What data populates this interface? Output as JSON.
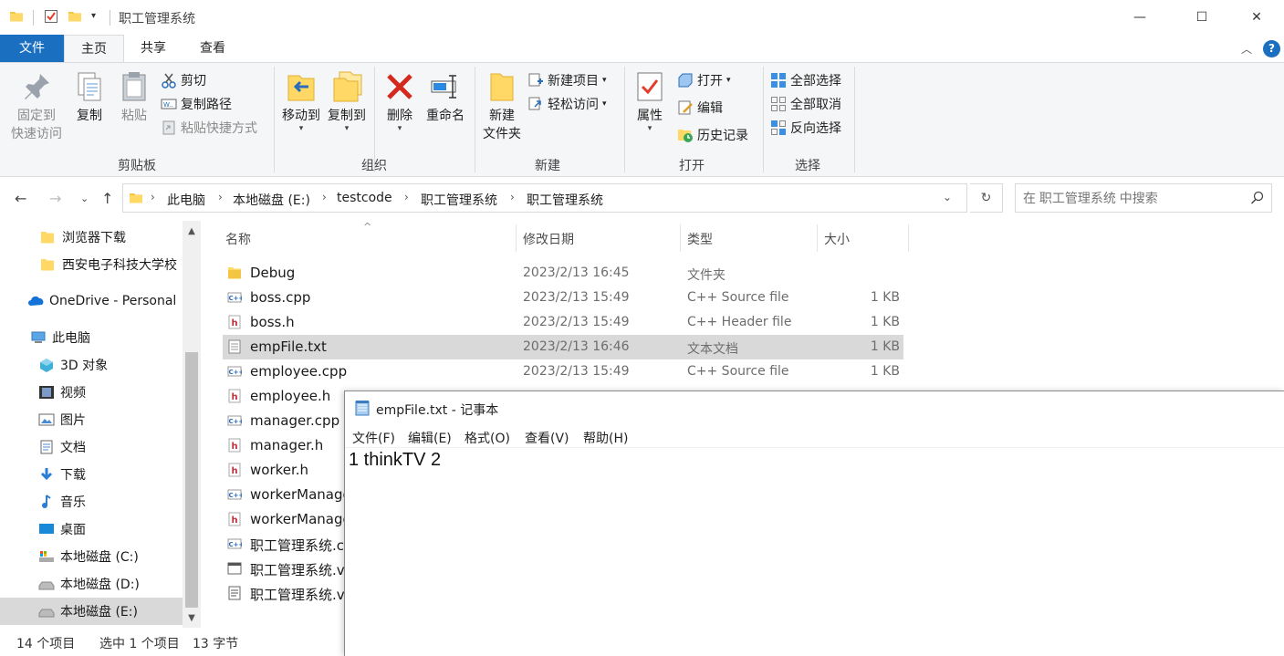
{
  "window": {
    "title": "职工管理系统",
    "minimize_glyph": "—",
    "maximize_glyph": "☐",
    "close_glyph": "✕"
  },
  "ribbon_tabs": [
    {
      "label": "文件"
    },
    {
      "label": "主页"
    },
    {
      "label": "共享"
    },
    {
      "label": "查看"
    }
  ],
  "ribbon": {
    "clipboard": {
      "pin": "固定到\n快速访问",
      "pin_line1": "固定到",
      "pin_line2": "快速访问",
      "copy": "复制",
      "paste": "粘贴",
      "cut": "剪切",
      "copy_path": "复制路径",
      "paste_shortcut": "粘贴快捷方式",
      "group_label": "剪贴板"
    },
    "organize": {
      "move_to": "移动到",
      "copy_to": "复制到",
      "delete": "删除",
      "rename": "重命名",
      "group_label": "组织"
    },
    "new": {
      "new_folder_line1": "新建",
      "new_folder_line2": "文件夹",
      "new_item": "新建项目",
      "easy_access": "轻松访问",
      "group_label": "新建"
    },
    "open": {
      "properties": "属性",
      "open": "打开",
      "edit": "编辑",
      "history": "历史记录",
      "group_label": "打开"
    },
    "select": {
      "select_all": "全部选择",
      "select_none": "全部取消",
      "invert": "反向选择",
      "group_label": "选择"
    }
  },
  "address": {
    "breadcrumbs": [
      "此电脑",
      "本地磁盘 (E:)",
      "testcode",
      "职工管理系统",
      "职工管理系统"
    ],
    "search_placeholder": "在 职工管理系统 中搜索"
  },
  "nav_pane": {
    "items": [
      {
        "label": "浏览器下载",
        "icon": "folder-icon"
      },
      {
        "label": "西安电子科技大学校",
        "icon": "folder-icon"
      },
      {
        "label": "OneDrive - Personal",
        "icon": "onedrive-icon"
      },
      {
        "label": "此电脑",
        "icon": "computer-icon"
      },
      {
        "label": "3D 对象",
        "icon": "3d-objects-icon"
      },
      {
        "label": "视频",
        "icon": "videos-icon"
      },
      {
        "label": "图片",
        "icon": "pictures-icon"
      },
      {
        "label": "文档",
        "icon": "documents-icon"
      },
      {
        "label": "下载",
        "icon": "downloads-icon"
      },
      {
        "label": "音乐",
        "icon": "music-icon"
      },
      {
        "label": "桌面",
        "icon": "desktop-icon"
      },
      {
        "label": "本地磁盘 (C:)",
        "icon": "drive-c-icon"
      },
      {
        "label": "本地磁盘 (D:)",
        "icon": "drive-icon"
      },
      {
        "label": "本地磁盘 (E:)",
        "icon": "drive-icon"
      }
    ]
  },
  "file_list": {
    "columns": [
      "名称",
      "修改日期",
      "类型",
      "大小"
    ],
    "rows": [
      {
        "name": "Debug",
        "date": "2023/2/13 16:45",
        "type": "文件夹",
        "size": "",
        "icon": "folder-icon"
      },
      {
        "name": "boss.cpp",
        "date": "2023/2/13 15:49",
        "type": "C++ Source file",
        "size": "1 KB",
        "icon": "cpp-file-icon"
      },
      {
        "name": "boss.h",
        "date": "2023/2/13 15:49",
        "type": "C++ Header file",
        "size": "1 KB",
        "icon": "header-file-icon"
      },
      {
        "name": "empFile.txt",
        "date": "2023/2/13 16:46",
        "type": "文本文档",
        "size": "1 KB",
        "icon": "text-file-icon"
      },
      {
        "name": "employee.cpp",
        "date": "2023/2/13 15:49",
        "type": "C++ Source file",
        "size": "1 KB",
        "icon": "cpp-file-icon"
      },
      {
        "name": "employee.h",
        "date": "",
        "type": "",
        "size": "",
        "icon": "header-file-icon"
      },
      {
        "name": "manager.cpp",
        "date": "",
        "type": "",
        "size": "",
        "icon": "cpp-file-icon"
      },
      {
        "name": "manager.h",
        "date": "",
        "type": "",
        "size": "",
        "icon": "header-file-icon"
      },
      {
        "name": "worker.h",
        "date": "",
        "type": "",
        "size": "",
        "icon": "header-file-icon"
      },
      {
        "name": "workerManage",
        "date": "",
        "type": "",
        "size": "",
        "icon": "cpp-file-icon"
      },
      {
        "name": "workerManage",
        "date": "",
        "type": "",
        "size": "",
        "icon": "header-file-icon"
      },
      {
        "name": "职工管理系统.c",
        "date": "",
        "type": "",
        "size": "",
        "icon": "cpp-file-icon"
      },
      {
        "name": "职工管理系统.v",
        "date": "",
        "type": "",
        "size": "",
        "icon": "vcxproj-file-icon"
      },
      {
        "name": "职工管理系统.v",
        "date": "",
        "type": "",
        "size": "",
        "icon": "filters-file-icon"
      }
    ]
  },
  "status_bar": {
    "item_count": "14 个项目",
    "selected": "选中 1 个项目",
    "size": "13 字节"
  },
  "notepad": {
    "title": "empFile.txt - 记事本",
    "menu": [
      "文件(F)",
      "编辑(E)",
      "格式(O)",
      "查看(V)",
      "帮助(H)"
    ],
    "content": "1 thinkTV 2"
  },
  "colors": {
    "accent": "#1a6fc0",
    "selection": "#d9d9d9",
    "folder": "#f4c542"
  }
}
